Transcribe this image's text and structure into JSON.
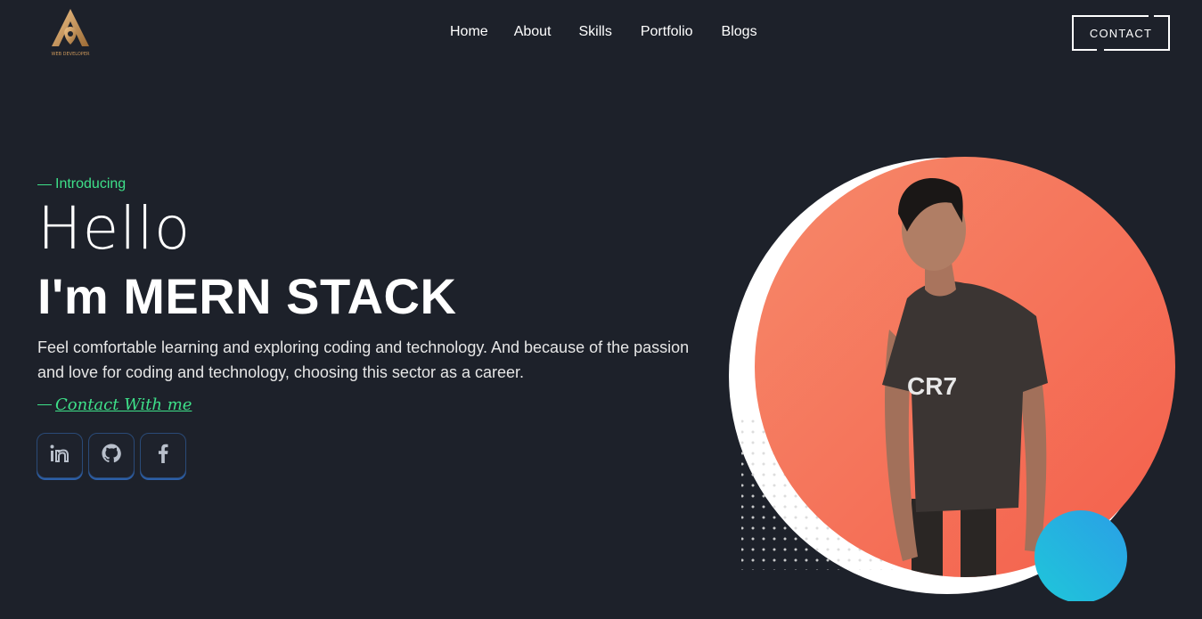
{
  "header": {
    "logo_icon": "pen-tool-logo",
    "logo_text": "WEB DEVELOPER",
    "nav": [
      {
        "label": "Home"
      },
      {
        "label": "About"
      },
      {
        "label": "Skills"
      },
      {
        "label": "Portfolio"
      },
      {
        "label": "Blogs"
      }
    ],
    "contact_label": "CONTACT"
  },
  "hero": {
    "intro": "Introducing",
    "greeting": "Hello",
    "role": "I'm MERN STACK",
    "description": "Feel comfortable learning and exploring coding and technology. And because of the passion and love for coding and technology, choosing this sector as a career.",
    "contact_link": "Contact With me",
    "socials": [
      {
        "icon": "linkedin-icon"
      },
      {
        "icon": "github-icon"
      },
      {
        "icon": "facebook-icon"
      }
    ],
    "shirt_text": "CR7"
  },
  "colors": {
    "background": "#1d212a",
    "accent_green": "#3ee089",
    "gradient_start": "#f6896a",
    "gradient_end": "#f45f4b",
    "teal": "#1fc7d9"
  }
}
